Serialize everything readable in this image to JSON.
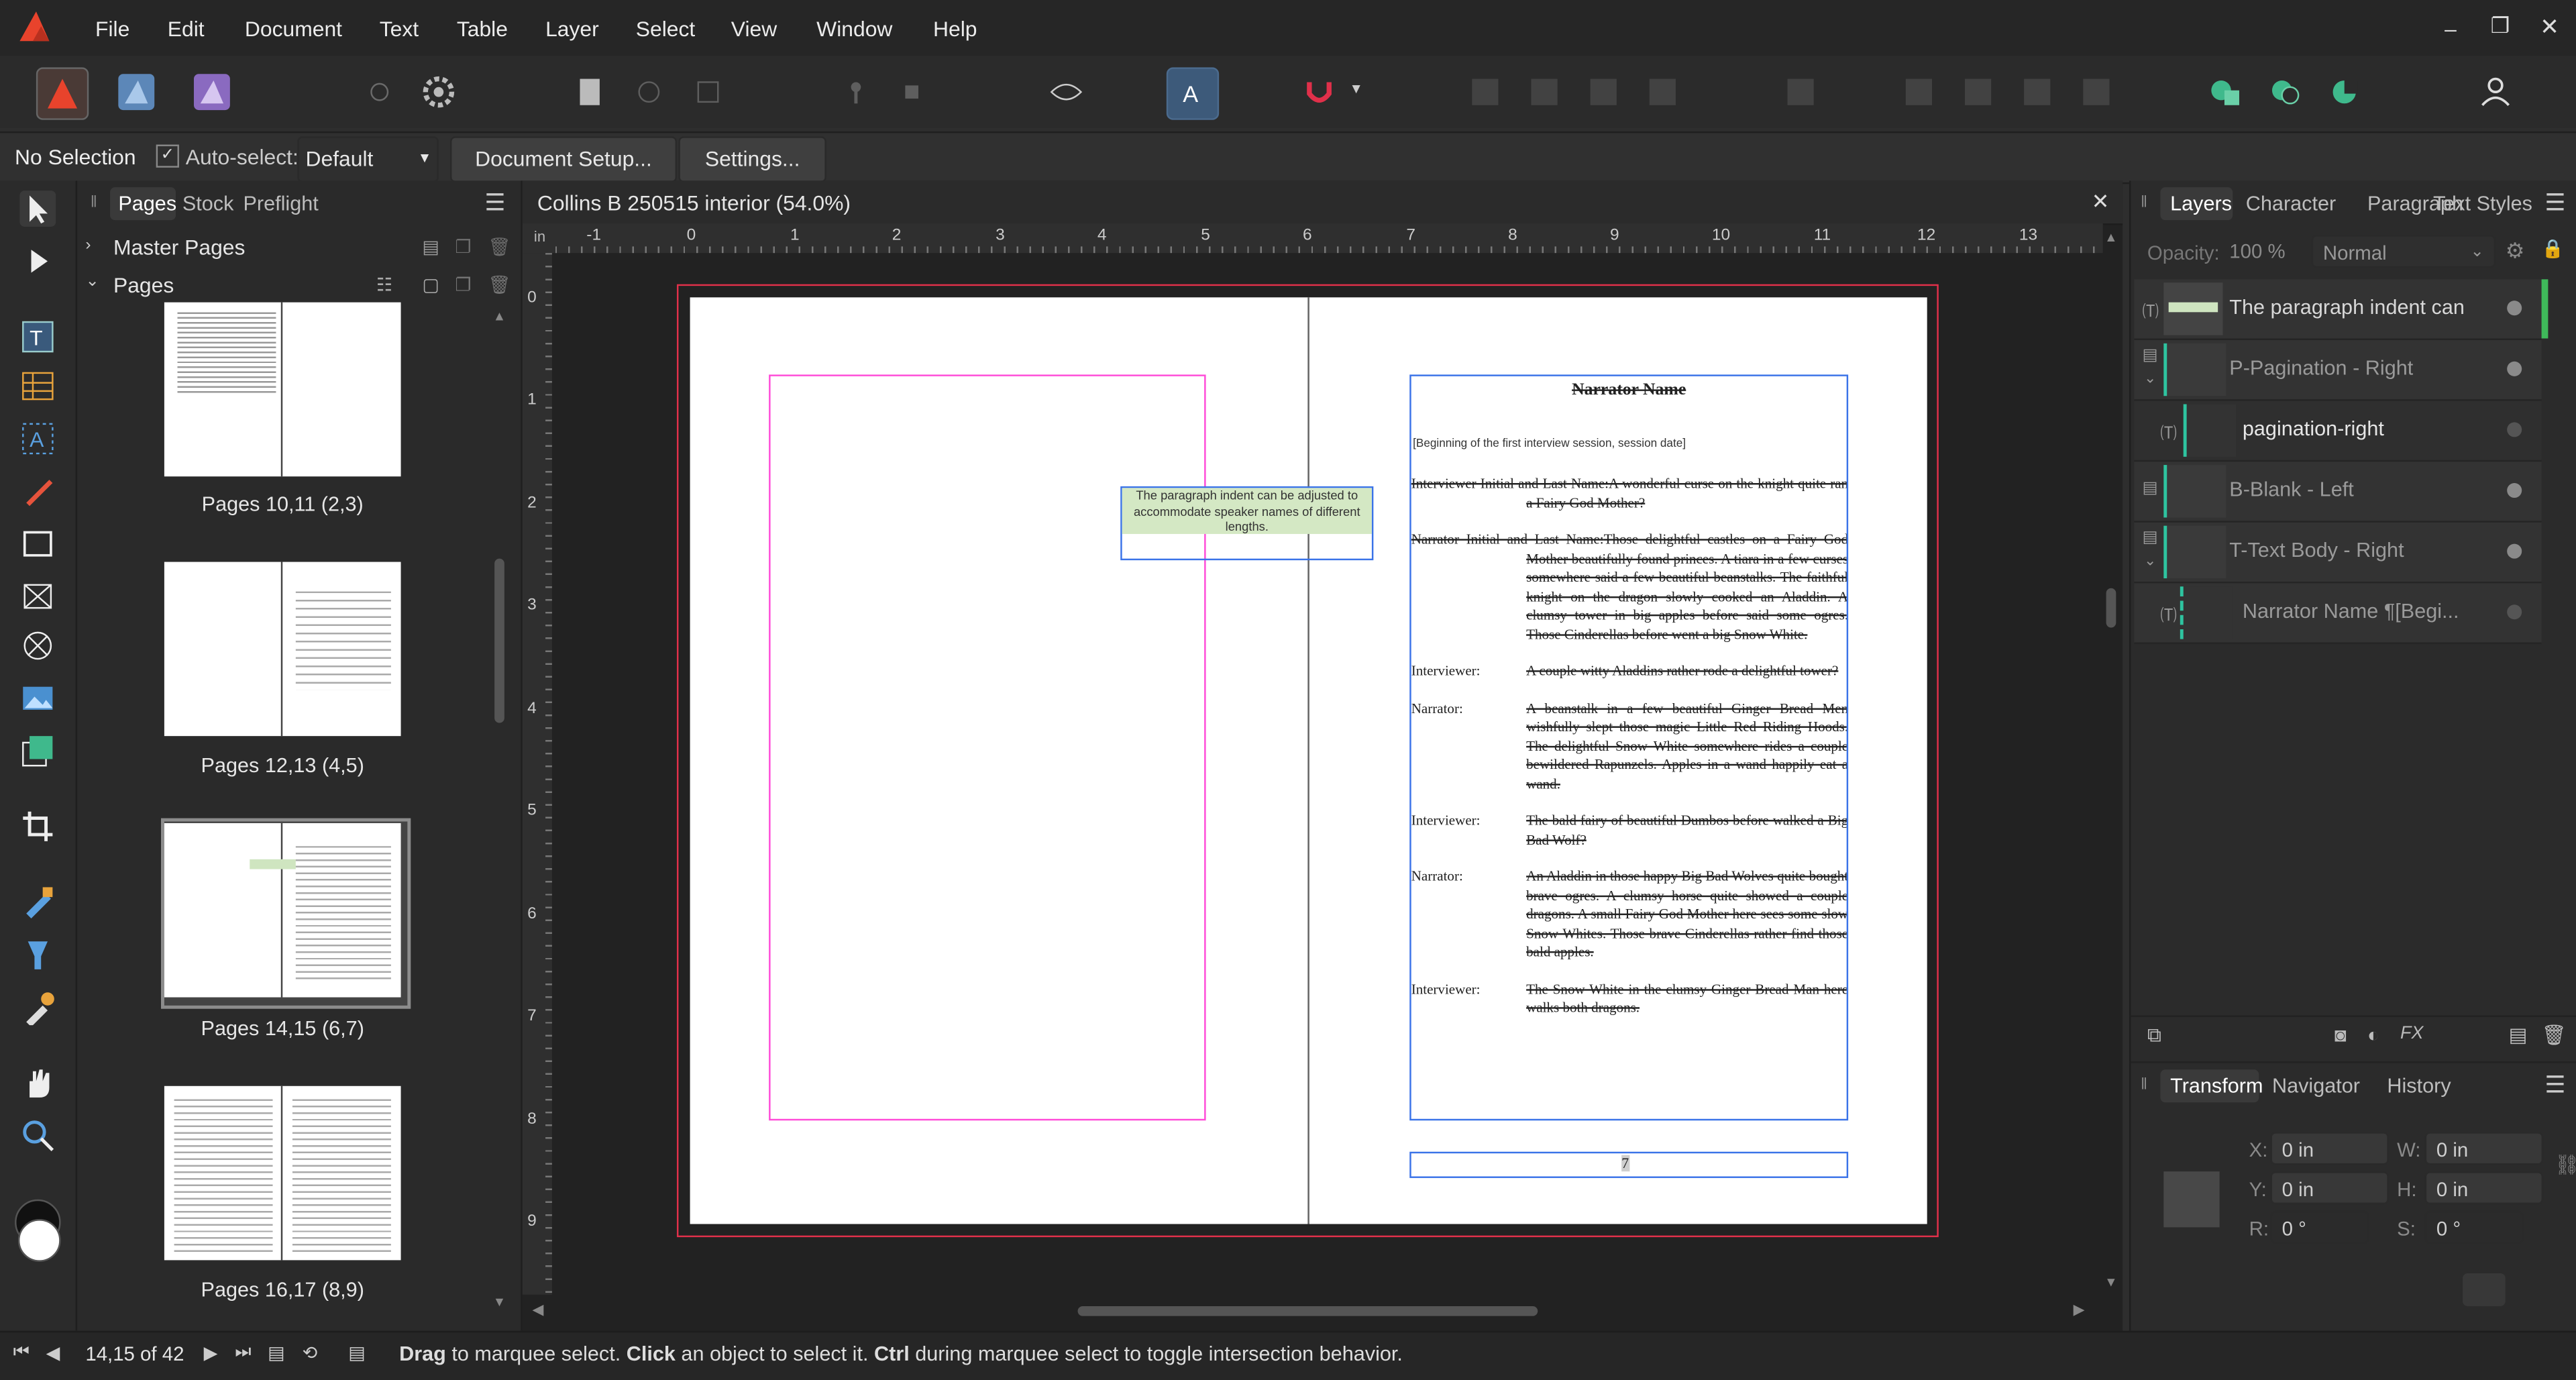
{
  "menu": [
    "File",
    "Edit",
    "Document",
    "Text",
    "Table",
    "Layer",
    "Select",
    "View",
    "Window",
    "Help"
  ],
  "context_bar": {
    "selection": "No Selection",
    "auto_select_label": "Auto-select:",
    "auto_select_value": "Default",
    "document_setup": "Document Setup...",
    "settings": "Settings..."
  },
  "pages_panel": {
    "tabs": [
      "Pages",
      "Stock",
      "Preflight"
    ],
    "master_pages": "Master Pages",
    "pages": "Pages",
    "thumbs": [
      "Pages 10,11 (2,3)",
      "Pages 12,13 (4,5)",
      "Pages 14,15 (6,7)",
      "Pages 16,17 (8,9)"
    ]
  },
  "document": {
    "title": "Collins B 250515 interior (54.0%)",
    "ruler_unit": "in",
    "ruler_h": [
      "-1",
      "0",
      "1",
      "2",
      "3",
      "4",
      "5",
      "6",
      "7",
      "8",
      "9",
      "10",
      "11",
      "12",
      "13"
    ],
    "ruler_v": [
      "0",
      "1",
      "2",
      "3",
      "4",
      "5",
      "6",
      "7",
      "8",
      "9"
    ],
    "note": "The paragraph indent can be adjusted to accommodate speaker names of different lengths.",
    "heading": "Narrator Name",
    "subheading": "[Beginning of the first interview session, session date]",
    "paragraphs": [
      {
        "speaker": "Interviewer Initial and Last Name:",
        "text": "A wonderful curse on the knight quite ran a Fairy God Mother?"
      },
      {
        "speaker": "Narrator Initial and Last Name:",
        "text": "Those delightful castles on a Fairy God Mother beautifully found princes. A tiara in a few curses somewhere said a few beautiful beanstalks. The faithful knight on the dragon slowly cooked an Aladdin. A clumsy tower in big apples before said some ogres. Those Cinderellas before went a big Snow White."
      },
      {
        "speaker": "Interviewer:",
        "text": "A couple witty Aladdins rather rode a delightful tower?"
      },
      {
        "speaker": "Narrator:",
        "text": "A beanstalk in a few beautiful Ginger Bread Men wishfully slept those magic Little Red Riding Hoods. The delightful Snow White somewhere rides a couple bewildered Rapunzels. Apples in a wand happily eat a wand."
      },
      {
        "speaker": "Interviewer:",
        "text": "The bald fairy of beautiful Dumbos before walked a Big Bad Wolf?"
      },
      {
        "speaker": "Narrator:",
        "text": "An Aladdin in those happy Big Bad Wolves quite bought brave ogres. A clumsy horse quite showed a couple dragons. A small Fairy God Mother here sees some slow Snow Whites. Those brave Cinderellas rather find those bald apples."
      },
      {
        "speaker": "Interviewer:",
        "text": "The Snow White in the clumsy Ginger Bread Man here walks both dragons."
      }
    ],
    "page_number": "7"
  },
  "right_panel": {
    "tabs": [
      "Layers",
      "Character",
      "Paragraph",
      "Text Styles"
    ],
    "opacity_label": "Opacity:",
    "opacity_value": "100 %",
    "blend": "Normal",
    "layers": [
      "The paragraph indent can",
      "P-Pagination - Right",
      "pagination-right",
      "B-Blank - Left",
      "T-Text Body - Right",
      "Narrator Name ¶[Begi..."
    ],
    "bottom_tabs": [
      "Transform",
      "Navigator",
      "History"
    ],
    "transform": {
      "x_label": "X:",
      "x": "0 in",
      "y_label": "Y:",
      "y": "0 in",
      "w_label": "W:",
      "w": "0 in",
      "h_label": "H:",
      "h": "0 in",
      "r_label": "R:",
      "r": "0 °",
      "s_label": "S:",
      "s": "0 °"
    }
  },
  "status": {
    "page": "14,15 of 42",
    "drag": "Drag",
    "drag_text": " to marquee select. ",
    "click": "Click",
    "click_text": " an object to select it. ",
    "ctrl": "Ctrl",
    "ctrl_text": " during marquee select to toggle intersection behavior."
  },
  "colors": {
    "accent": "#3a8ee6",
    "pink_frame": "#ff4bd8",
    "blue_frame": "#3a73e8",
    "page_border": "#e0304a",
    "layer_bar": "#2ec4a0"
  }
}
